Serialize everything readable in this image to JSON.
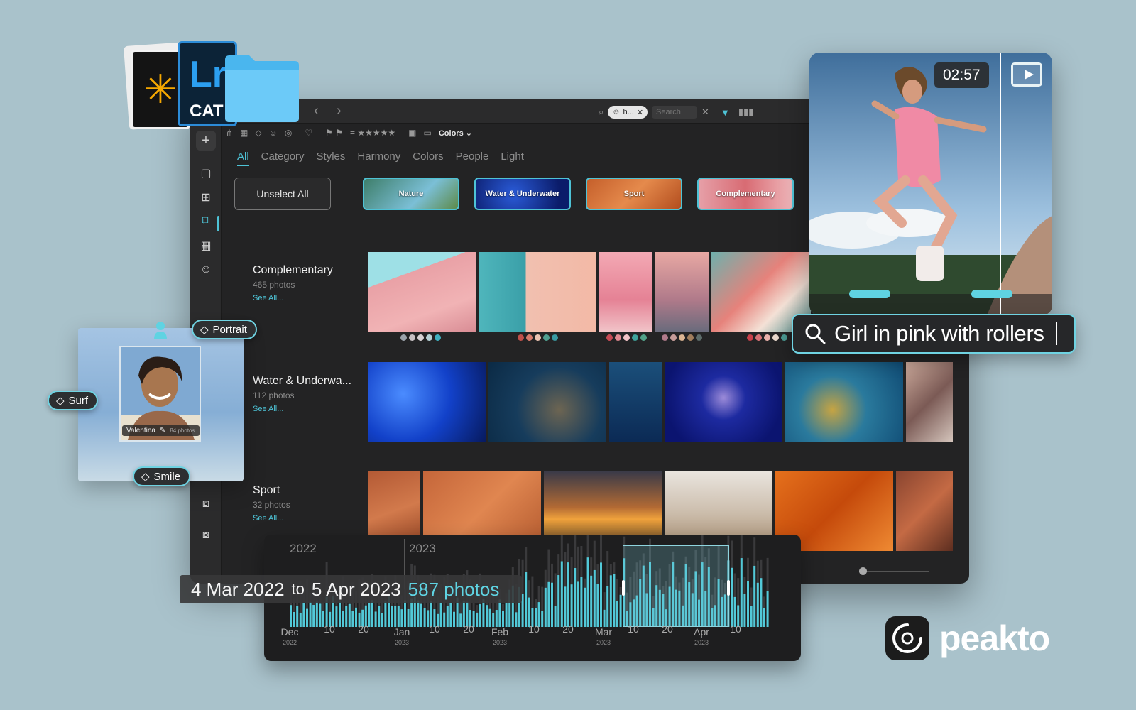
{
  "window": {
    "search_chip": "h...",
    "search_placeholder": "Search",
    "colors_label": "Colors",
    "rating": "= ★★★★★"
  },
  "tabs": [
    {
      "label": "All",
      "active": true
    },
    {
      "label": "Category"
    },
    {
      "label": "Styles"
    },
    {
      "label": "Harmony"
    },
    {
      "label": "Colors"
    },
    {
      "label": "People"
    },
    {
      "label": "Light"
    }
  ],
  "unselect_label": "Unselect All",
  "chips": [
    {
      "label": "Nature"
    },
    {
      "label": "Water & Underwater"
    },
    {
      "label": "Sport"
    },
    {
      "label": "Complementary"
    }
  ],
  "rows": [
    {
      "title": "Complementary",
      "count": "465 photos",
      "see_all": "See All..."
    },
    {
      "title": "Water & Underwa...",
      "count": "112 photos",
      "see_all": "See All..."
    },
    {
      "title": "Sport",
      "count": "32 photos",
      "see_all": "See All..."
    }
  ],
  "catalog": {
    "lr": "Lr",
    "cat": "CAT"
  },
  "person": {
    "name": "Valentina",
    "photos": "84 photos"
  },
  "tags": {
    "portrait": "Portrait",
    "surf": "Surf",
    "smile": "Smile"
  },
  "video": {
    "time": "02:57"
  },
  "search_query": "Girl in pink with rollers",
  "timeline": {
    "year_left": "2022",
    "year_right": "2023",
    "range_text": "4 Mar 2022",
    "range_to": "to",
    "range_end": "5 Apr 2023",
    "range_count": "587 photos",
    "axis": [
      {
        "label": "Dec",
        "year": "2022"
      },
      {
        "label": "10"
      },
      {
        "label": "20"
      },
      {
        "label": "Jan",
        "year": "2023"
      },
      {
        "label": "10"
      },
      {
        "label": "20"
      },
      {
        "label": "Feb",
        "year": "2023"
      },
      {
        "label": "10"
      },
      {
        "label": "20"
      },
      {
        "label": "Mar",
        "year": "2023"
      },
      {
        "label": "10"
      },
      {
        "label": "20"
      },
      {
        "label": "Apr",
        "year": "2023"
      },
      {
        "label": "10"
      }
    ]
  },
  "brand": {
    "name": "peakto"
  },
  "colors": {
    "accent": "#4ec3d6",
    "background": "#a9c2cb",
    "panel": "#232324"
  }
}
